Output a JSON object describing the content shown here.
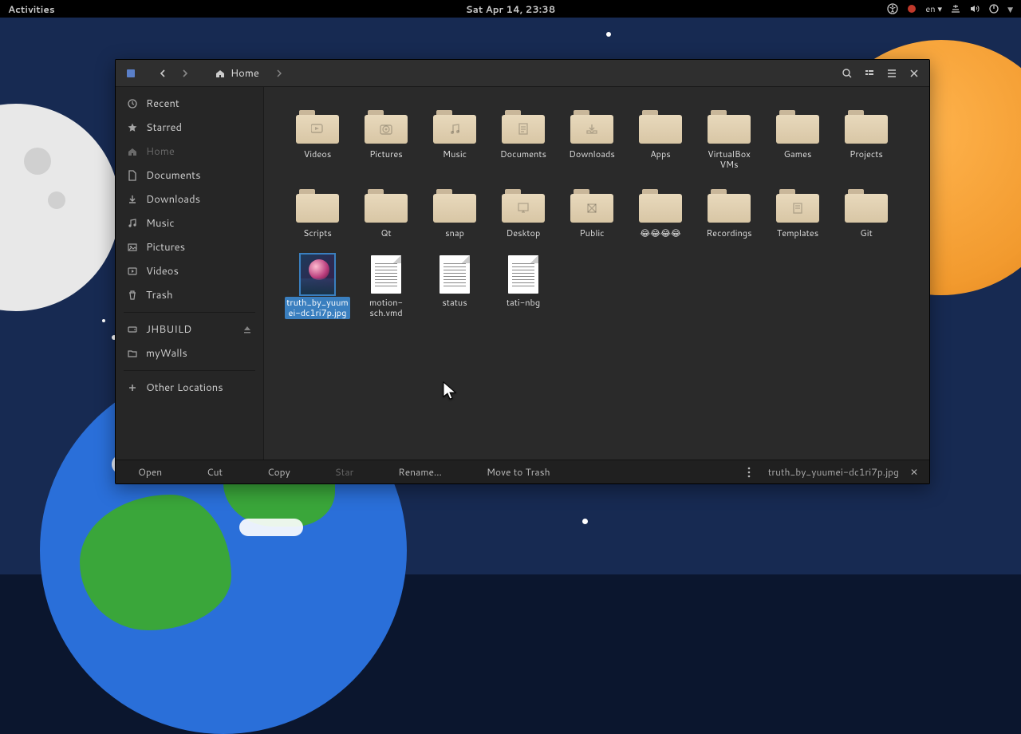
{
  "panel": {
    "activities": "Activities",
    "clock": "Sat Apr 14, 23:38",
    "lang": "en"
  },
  "titlebar": {
    "path_label": "Home"
  },
  "sidebar": {
    "items": [
      {
        "label": "Recent",
        "icon": "clock"
      },
      {
        "label": "Starred",
        "icon": "star"
      },
      {
        "label": "Home",
        "icon": "home",
        "dim": true
      },
      {
        "label": "Documents",
        "icon": "doc"
      },
      {
        "label": "Downloads",
        "icon": "down"
      },
      {
        "label": "Music",
        "icon": "music"
      },
      {
        "label": "Pictures",
        "icon": "pic"
      },
      {
        "label": "Videos",
        "icon": "vid"
      },
      {
        "label": "Trash",
        "icon": "trash"
      },
      {
        "label": "JHBUILD",
        "icon": "drive",
        "eject": true
      },
      {
        "label": "myWalls",
        "icon": "folder"
      },
      {
        "label": "Other Locations",
        "icon": "plus"
      }
    ]
  },
  "folders": [
    {
      "label": "Videos",
      "glyph": "video"
    },
    {
      "label": "Pictures",
      "glyph": "camera"
    },
    {
      "label": "Music",
      "glyph": "note"
    },
    {
      "label": "Documents",
      "glyph": "page"
    },
    {
      "label": "Downloads",
      "glyph": "inbox"
    },
    {
      "label": "Apps",
      "glyph": ""
    },
    {
      "label": "VirtualBox VMs",
      "glyph": ""
    },
    {
      "label": "Games",
      "glyph": ""
    },
    {
      "label": "Projects",
      "glyph": ""
    },
    {
      "label": "Scripts",
      "glyph": ""
    },
    {
      "label": "Qt",
      "glyph": ""
    },
    {
      "label": "snap",
      "glyph": ""
    },
    {
      "label": "Desktop",
      "glyph": "desktop"
    },
    {
      "label": "Public",
      "glyph": "public"
    },
    {
      "label": "😂😂😂😂",
      "glyph": ""
    },
    {
      "label": "Recordings",
      "glyph": ""
    },
    {
      "label": "Templates",
      "glyph": "template"
    },
    {
      "label": "Git",
      "glyph": ""
    }
  ],
  "files": [
    {
      "label": "truth_by_yuumei-dc1ri7p.jpg",
      "type": "image",
      "selected": true
    },
    {
      "label": "motion-sch.vmd",
      "type": "doc"
    },
    {
      "label": "status",
      "type": "doc"
    },
    {
      "label": "tati-nbg",
      "type": "doc"
    }
  ],
  "actionbar": {
    "open": "Open",
    "cut": "Cut",
    "copy": "Copy",
    "star": "Star",
    "rename": "Rename…",
    "trash": "Move to Trash",
    "selection": "truth_by_yuumei-dc1ri7p.jpg"
  }
}
